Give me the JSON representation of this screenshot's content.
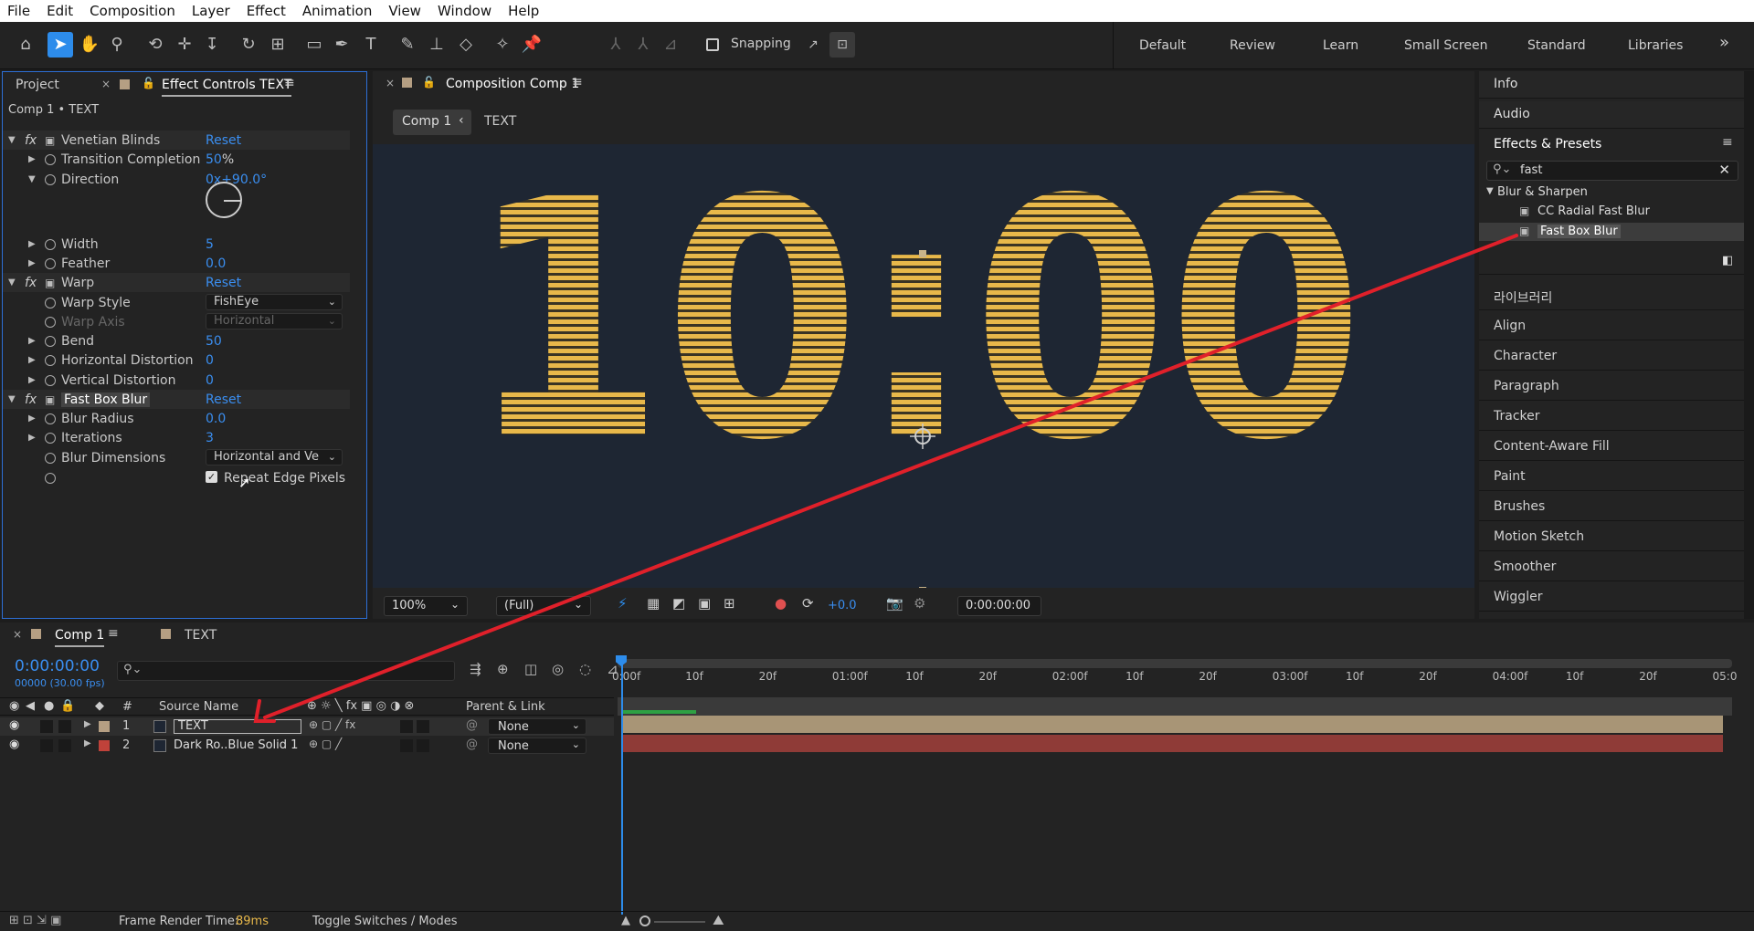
{
  "menu": [
    "File",
    "Edit",
    "Composition",
    "Layer",
    "Effect",
    "Animation",
    "View",
    "Window",
    "Help"
  ],
  "toolbar": {
    "snapping_label": "Snapping",
    "workspaces": [
      "Default",
      "Review",
      "Learn",
      "Small Screen",
      "Standard",
      "Libraries"
    ],
    "more": "»"
  },
  "left_panel": {
    "tab_project": "Project",
    "tab_effect_controls": "Effect Controls TEXT",
    "breadcrumb": "Comp 1 • TEXT",
    "rows": [
      {
        "label": "Venetian Blinds",
        "value": "Reset",
        "kind": "fx"
      },
      {
        "label": "Transition Completion",
        "value": "50",
        "unit": "%",
        "kind": "prop"
      },
      {
        "label": "Direction",
        "value": "0x+90.0°",
        "kind": "prop"
      },
      {
        "label": "Width",
        "value": "5",
        "kind": "prop"
      },
      {
        "label": "Feather",
        "value": "0.0",
        "kind": "prop"
      },
      {
        "label": "Warp",
        "value": "Reset",
        "kind": "fx"
      },
      {
        "label": "Warp Style",
        "value": "FishEye",
        "kind": "dropdown"
      },
      {
        "label": "Warp Axis",
        "value": "Horizontal",
        "kind": "dropdown-disabled"
      },
      {
        "label": "Bend",
        "value": "50",
        "kind": "prop"
      },
      {
        "label": "Horizontal Distortion",
        "value": "0",
        "kind": "prop"
      },
      {
        "label": "Vertical Distortion",
        "value": "0",
        "kind": "prop"
      },
      {
        "label": "Fast Box Blur",
        "value": "Reset",
        "kind": "fx"
      },
      {
        "label": "Blur Radius",
        "value": "0.0",
        "kind": "prop"
      },
      {
        "label": "Iterations",
        "value": "3",
        "kind": "prop"
      },
      {
        "label": "Blur Dimensions",
        "value": "Horizontal and Ve",
        "kind": "dropdown"
      },
      {
        "label": "",
        "value": "Repeat Edge Pixels",
        "kind": "checkbox"
      }
    ]
  },
  "composition": {
    "tab": "Composition Comp 1",
    "crumb_comp": "Comp 1",
    "crumb_layer": "TEXT",
    "display_text": "10:00",
    "zoom": "100%",
    "resolution": "(Full)",
    "exposure": "+0.0",
    "timecode": "0:00:00:00"
  },
  "right_panel": {
    "info": "Info",
    "audio": "Audio",
    "effects_presets": "Effects & Presets",
    "search_value": "fast",
    "category": "Blur & Sharpen",
    "effects": [
      "CC Radial Fast Blur",
      "Fast Box Blur"
    ],
    "items": [
      "라이브러리",
      "Align",
      "Character",
      "Paragraph",
      "Tracker",
      "Content-Aware Fill",
      "Paint",
      "Brushes",
      "Motion Sketch",
      "Smoother",
      "Wiggler"
    ]
  },
  "timeline": {
    "tab_comp": "Comp 1",
    "tab_text": "TEXT",
    "timecode": "0:00:00:00",
    "fps": "00000 (30.00 fps)",
    "col_hash": "#",
    "col_source": "Source Name",
    "col_parent": "Parent & Link",
    "ticks": [
      "0:00f",
      "10f",
      "20f",
      "01:00f",
      "10f",
      "20f",
      "02:00f",
      "10f",
      "20f",
      "03:00f",
      "10f",
      "20f",
      "04:00f",
      "10f",
      "20f",
      "05:0"
    ],
    "layers": [
      {
        "num": "1",
        "name": "TEXT",
        "parent": "None",
        "color": "#b59f83"
      },
      {
        "num": "2",
        "name": "Dark Ro..Blue Solid 1",
        "parent": "None",
        "color": "#c0423a"
      }
    ],
    "frame_render_label": "Frame Render Time:",
    "frame_render_value": "89ms",
    "toggle": "Toggle Switches / Modes"
  },
  "colors": {
    "accent": "#2d8ceb",
    "text_fill": "#e8b84a",
    "comp_bg": "#1f2937",
    "layer1_bar": "#a89576",
    "layer2_bar": "#8f3b37",
    "arrow": "#e0202a"
  }
}
